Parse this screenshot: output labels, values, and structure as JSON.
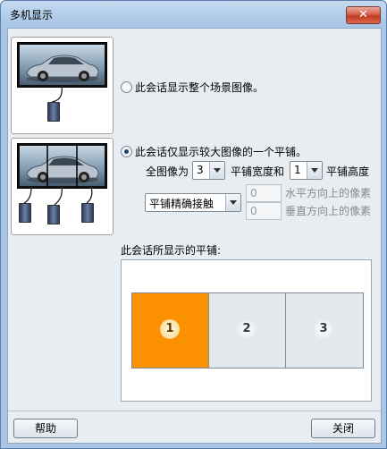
{
  "window": {
    "title": "多机显示",
    "close_glyph": "✕"
  },
  "option_full": {
    "label": "此会话显示整个场景图像。",
    "selected": false
  },
  "option_tile": {
    "label": "此会话仅显示较大图像的一个平铺。",
    "selected": true
  },
  "grid": {
    "prefix_label": "全图像为",
    "columns_value": "3",
    "width_label": "平铺宽度和",
    "rows_value": "1",
    "height_label": "平铺高度"
  },
  "fit": {
    "mode_value": "平铺精确接触",
    "horizontal_value": "0",
    "horizontal_label": "水平方向上的像素",
    "vertical_value": "0",
    "vertical_label": "垂直方向上的像素"
  },
  "tiles": {
    "heading": "此会话所显示的平铺:",
    "items": [
      {
        "label": "1",
        "selected": true
      },
      {
        "label": "2",
        "selected": false
      },
      {
        "label": "3",
        "selected": false
      }
    ]
  },
  "footer": {
    "help_label": "帮助",
    "close_label": "关闭"
  },
  "colors": {
    "selected_tile": "#fb9100",
    "tile_bg": "#e3e8ed",
    "window_frame": "#a9c6e6"
  }
}
